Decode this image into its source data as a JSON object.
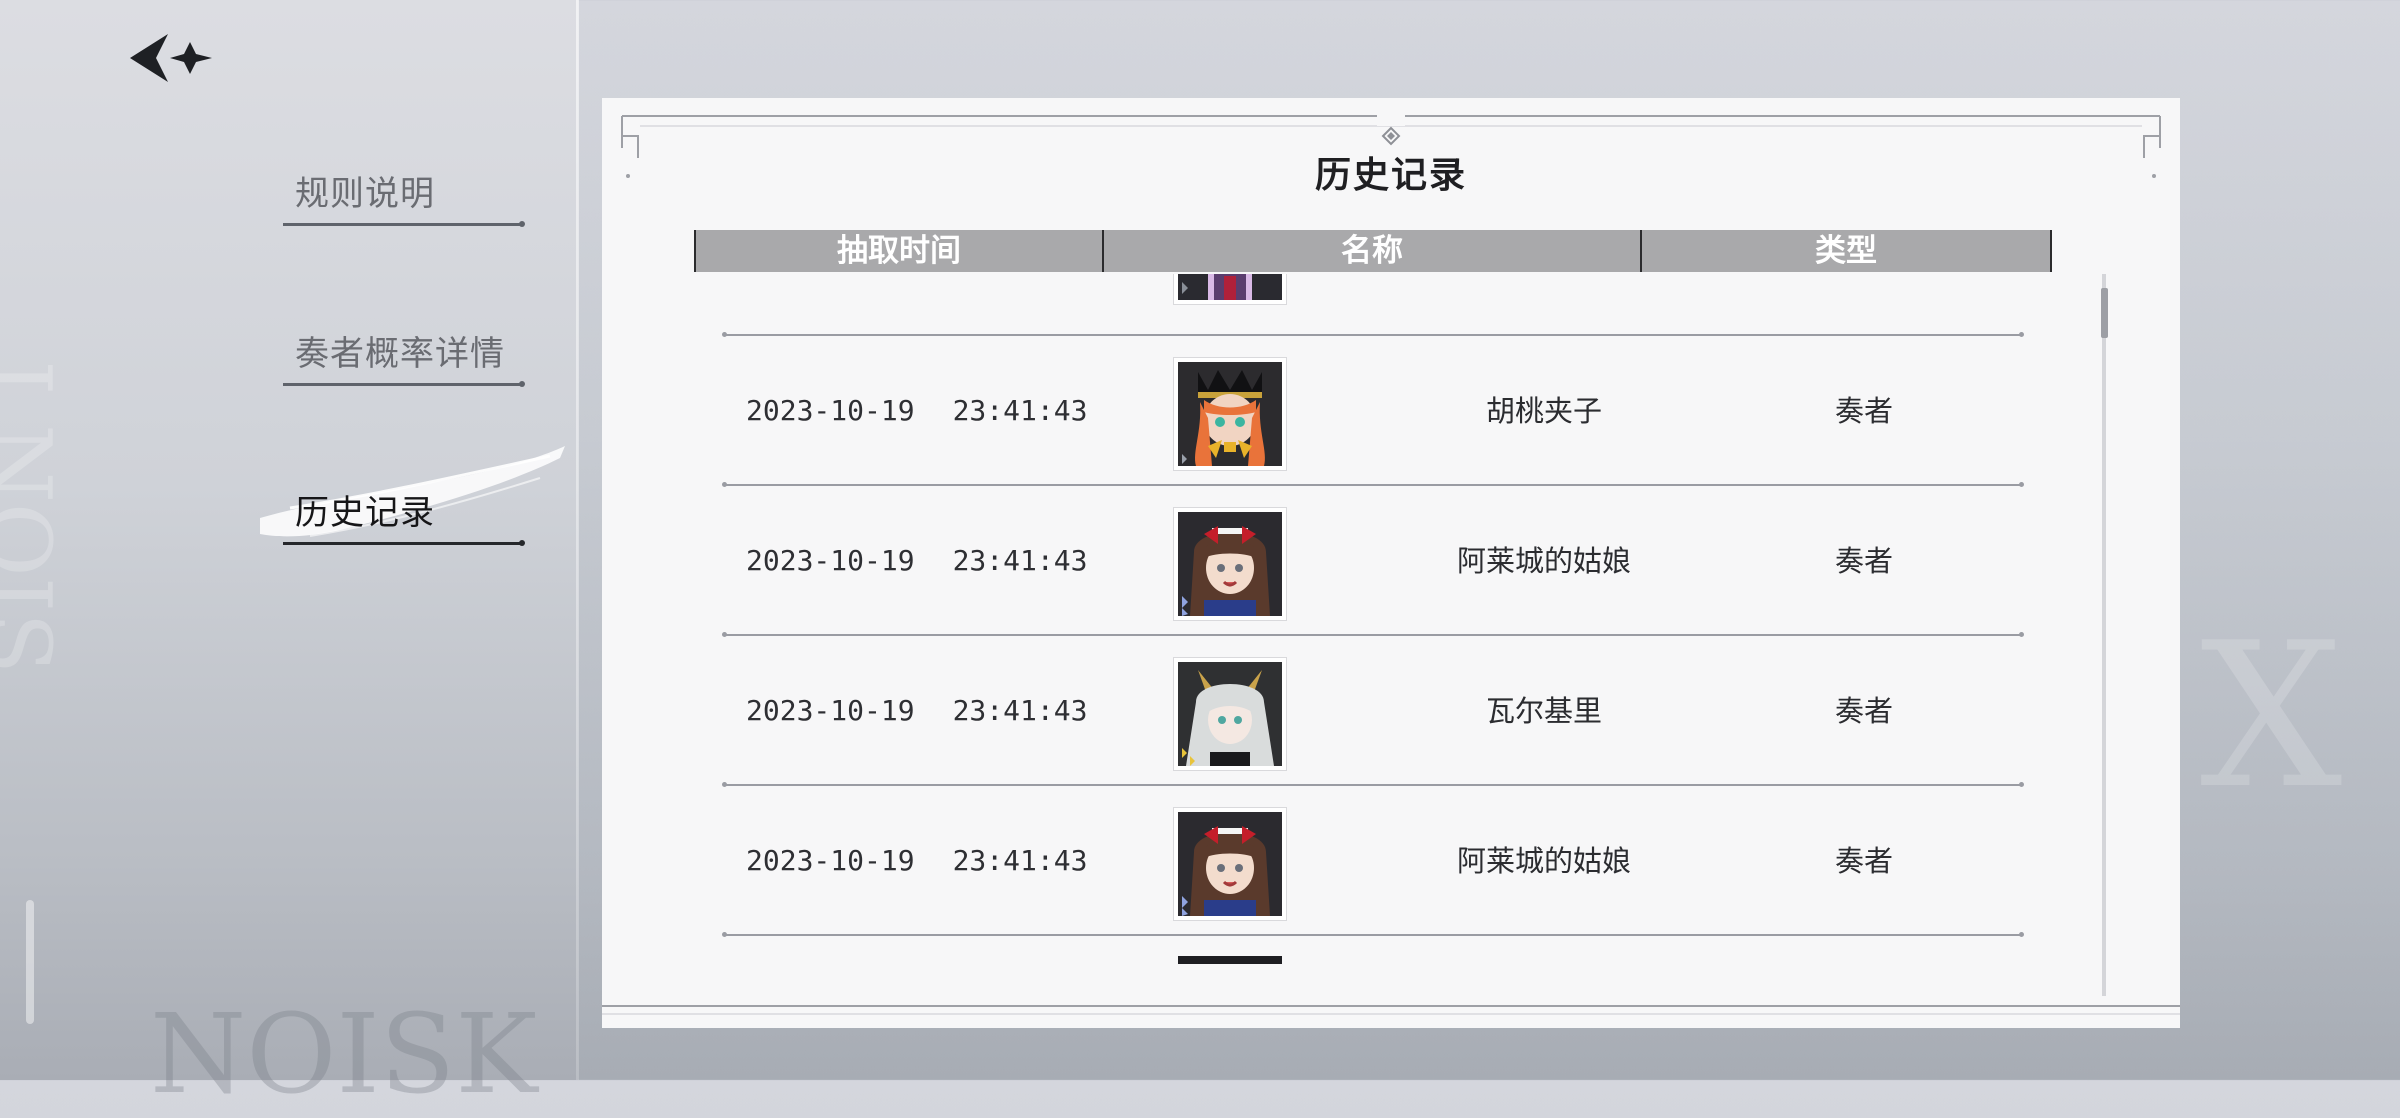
{
  "nav": {
    "back_icon": "back-arrow-star-icon",
    "items": [
      {
        "label": "规则说明",
        "active": false
      },
      {
        "label": "奏者概率详情",
        "active": false
      },
      {
        "label": "历史记录",
        "active": true
      }
    ]
  },
  "panel": {
    "title": "历史记录",
    "columns": [
      "抽取时间",
      "名称",
      "类型"
    ]
  },
  "records": [
    {
      "date": "2023-10-19",
      "time": "23:41:43",
      "name": "胡桃夹子",
      "type": "奏者",
      "avatar": "nutcracker-avatar-icon"
    },
    {
      "date": "2023-10-19",
      "time": "23:41:43",
      "name": "阿莱城的姑娘",
      "type": "奏者",
      "avatar": "arlesienne-avatar-icon"
    },
    {
      "date": "2023-10-19",
      "time": "23:41:43",
      "name": "瓦尔基里",
      "type": "奏者",
      "avatar": "valkyrie-avatar-icon"
    },
    {
      "date": "2023-10-19",
      "time": "23:41:43",
      "name": "阿莱城的姑娘",
      "type": "奏者",
      "avatar": "arlesienne-avatar-icon"
    }
  ],
  "colors": {
    "header_bg": "#a9a9ab",
    "panel_bg": "#f7f7f8",
    "active_text": "#161618",
    "inactive_text": "#6a6c72"
  }
}
